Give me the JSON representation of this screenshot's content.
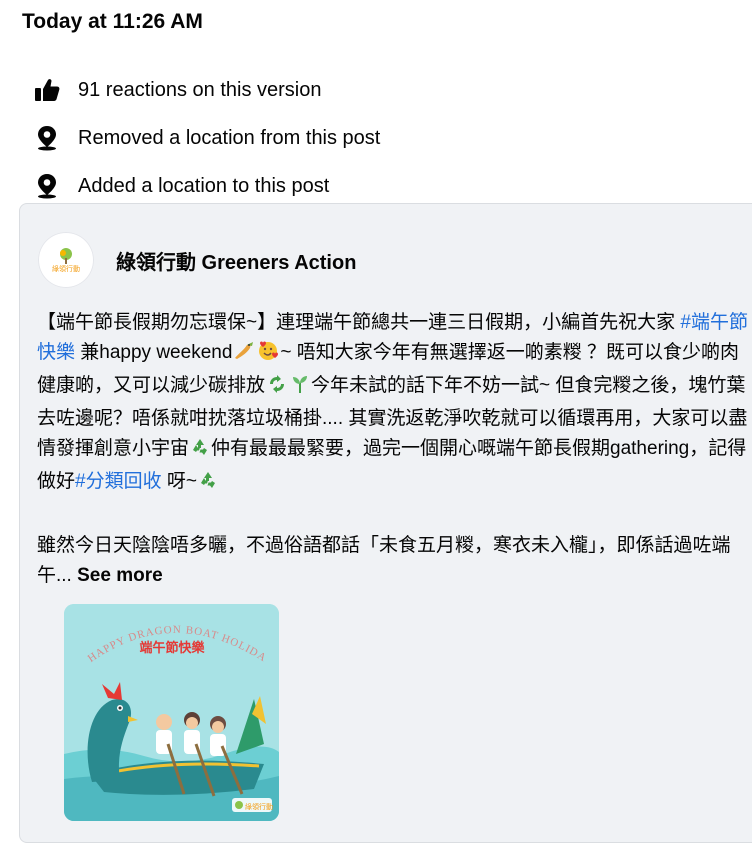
{
  "timestamp": "Today at 11:26 AM",
  "history": [
    {
      "icon": "thumbs-up-icon",
      "text": "91 reactions on this version"
    },
    {
      "icon": "location-pin-icon",
      "text": "Removed a location from this post"
    },
    {
      "icon": "location-pin-icon",
      "text": "Added a location to this post"
    }
  ],
  "post": {
    "author": "綠領行動 Greeners Action",
    "avatar_text": "綠領行動",
    "text": {
      "p1": "【端午節長假期勿忘環保~】連理端午節總共一連三日假期，小編首先祝大家 ",
      "hashtag1": "#端午節快樂",
      "p2": " 兼happy weekend",
      "p3": "~ 唔知大家今年有無選擇返一啲素糉 ？既可以食少啲肉健康啲，又可以減少碳排放",
      "p4": "今年未試的話下年不妨一試~ 但食完糉之後，塊竹葉去咗邊呢？唔係就咁抌落垃圾桶掛.... 其實洗返乾淨吹乾就可以循環再用，大家可以盡情發揮創意小宇宙",
      "p5": "仲有最最最緊要，過完一個開心嘅端午節長假期gathering，記得做好",
      "hashtag2": "#分類回收",
      "p6": " 呀~"
    },
    "para2": "雖然今日天陰陰唔多曬，不過俗語都話「未食五月糉，寒衣未入櫳」，即係話過咗端午...",
    "see_more": "See more",
    "image": {
      "arc_text": "HAPPY DRAGON BOAT HOLIDAY",
      "title": "端午節快樂",
      "logo_text": "綠領行動"
    }
  },
  "colors": {
    "hashtag": "#216fdb",
    "card_bg": "#f0f2f5"
  }
}
